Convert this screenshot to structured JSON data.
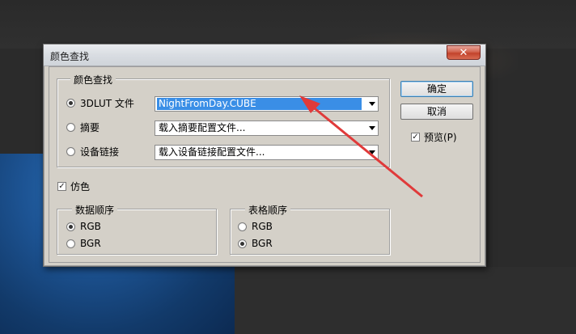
{
  "dialog": {
    "title": "颜色查找",
    "close_label": "✕",
    "lookup_group": {
      "legend": "颜色查找",
      "options": [
        {
          "label": "3DLUT 文件",
          "checked": true,
          "select_value": "NightFromDay.CUBE"
        },
        {
          "label": "摘要",
          "checked": false,
          "select_value": "载入摘要配置文件..."
        },
        {
          "label": "设备链接",
          "checked": false,
          "select_value": "载入设备链接配置文件..."
        }
      ]
    },
    "dither": {
      "label": "仿色",
      "checked": true
    },
    "data_order": {
      "legend": "数据顺序",
      "options": [
        {
          "label": "RGB",
          "checked": true
        },
        {
          "label": "BGR",
          "checked": false
        }
      ]
    },
    "table_order": {
      "legend": "表格顺序",
      "options": [
        {
          "label": "RGB",
          "checked": false
        },
        {
          "label": "BGR",
          "checked": true
        }
      ]
    },
    "buttons": {
      "ok": "确定",
      "cancel": "取消"
    },
    "preview": {
      "label": "预览(P)",
      "checked": true
    }
  },
  "annotation": {
    "color": "#e03a3a"
  }
}
